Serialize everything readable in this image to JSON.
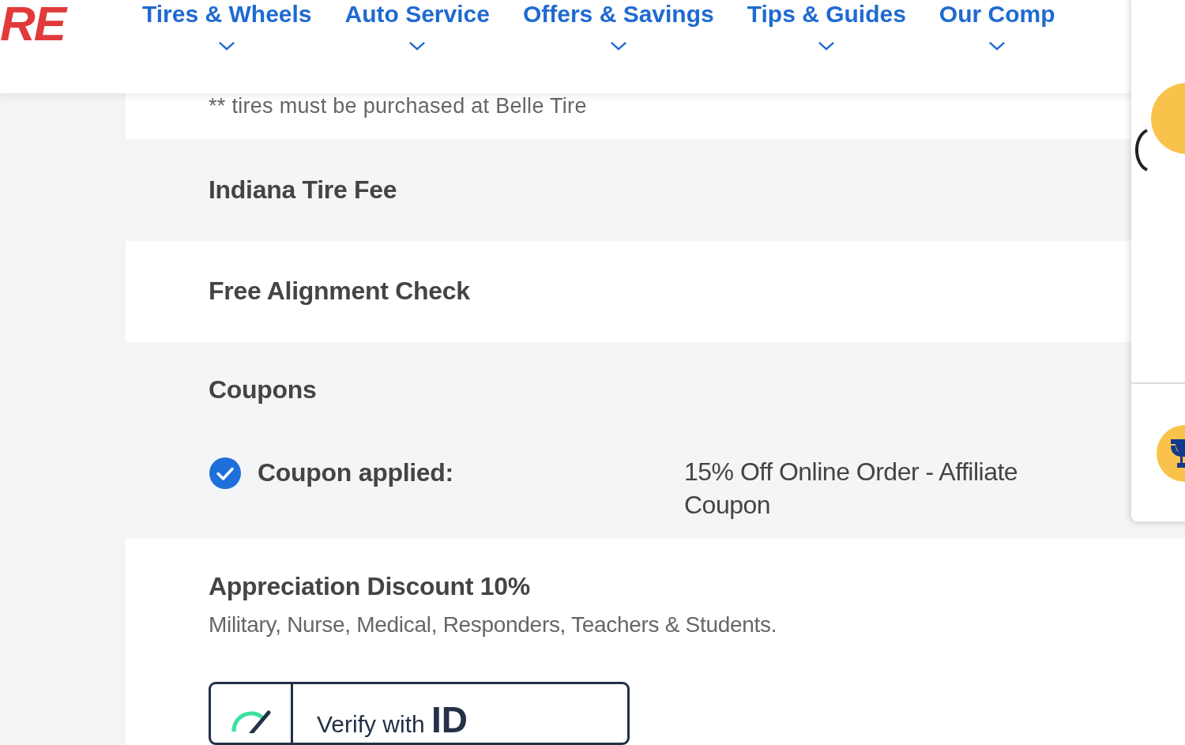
{
  "header": {
    "logo_text": "RE",
    "nav": [
      {
        "label": "Tires & Wheels"
      },
      {
        "label": "Auto Service"
      },
      {
        "label": "Offers & Savings"
      },
      {
        "label": "Tips & Guides"
      },
      {
        "label": "Our Comp"
      }
    ]
  },
  "note": "** tires must be purchased at Belle Tire",
  "rows": [
    {
      "kind": "title",
      "title": "Indiana Tire Fee"
    },
    {
      "kind": "title",
      "title": "Free Alignment Check"
    },
    {
      "kind": "coupons",
      "title": "Coupons",
      "applied": {
        "checked": true,
        "label": "Coupon applied:",
        "value": "15% Off Online Order - Affiliate Coupon"
      }
    },
    {
      "kind": "discount",
      "title": "Appreciation Discount 10%",
      "description": "Military, Nurse, Medical, Responders, Teachers & Students.",
      "button": "Verify with **ID**"
    }
  ]
}
